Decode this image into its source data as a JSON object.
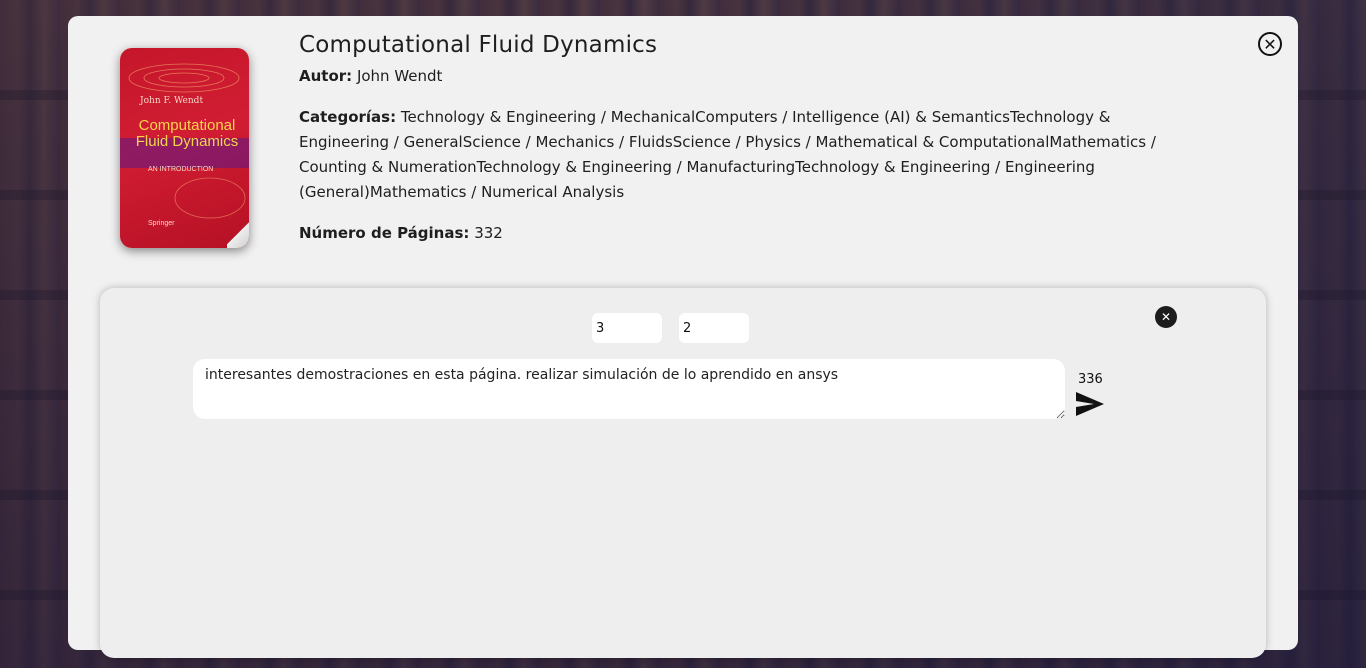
{
  "book": {
    "title": "Computational Fluid Dynamics",
    "author_label": "Autor:",
    "author": "John Wendt",
    "categories_label": "Categorías:",
    "categories": "Technology & Engineering / MechanicalComputers / Intelligence (AI) & SemanticsTechnology & Engineering / GeneralScience / Mechanics / FluidsScience / Physics / Mathematical & ComputationalMathematics / Counting & NumerationTechnology & Engineering / ManufacturingTechnology & Engineering / Engineering (General)Mathematics / Numerical Analysis",
    "pages_label": "Número de Páginas:",
    "pages": "332"
  },
  "cover": {
    "author": "John F. Wendt",
    "title": "Computational Fluid Dynamics",
    "subtitle": "AN INTRODUCTION",
    "publisher": "Springer",
    "colors": {
      "background": "#c4162a",
      "title": "#f7d34a"
    }
  },
  "note": {
    "field_a_value": "3",
    "field_b_value": "2",
    "text": "interesantes demostraciones en esta página. realizar simulación de lo aprendido en ansys",
    "page_number": "336"
  },
  "icons": {
    "close_modal": "close-circle-icon",
    "close_note": "close-filled-icon",
    "send": "send-arrow-icon"
  },
  "glyphs": {
    "close": "✕"
  }
}
